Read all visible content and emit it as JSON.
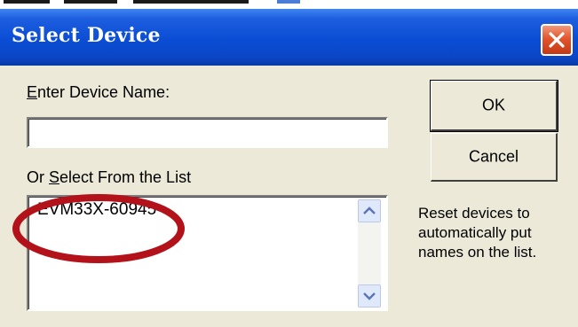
{
  "dialog": {
    "title": "Select Device",
    "enter_name_label_accel": "E",
    "enter_name_label_rest": "nter Device Name:",
    "device_name_value": "",
    "select_list_label_prefix": "Or ",
    "select_list_label_accel": "S",
    "select_list_label_rest": "elect From the List",
    "device_list": [
      "EVM33X-60945"
    ],
    "ok_label": "OK",
    "cancel_label": "Cancel",
    "hint_text": "Reset devices to automatically put names on the list."
  },
  "colors": {
    "titlebar": "#0a4dd4",
    "dialog_background": "#ece9d8",
    "close_button": "#e2562e",
    "annotation_ring": "#b3121a"
  },
  "icons": {
    "close": "close-x-icon",
    "scroll_up": "scroll-up-arrow-icon",
    "scroll_down": "scroll-down-arrow-icon"
  }
}
